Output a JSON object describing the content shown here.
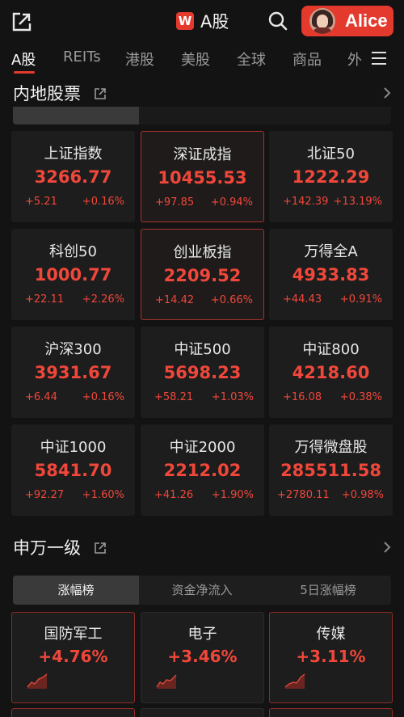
{
  "header": {
    "title": "A股",
    "logo_letter": "W",
    "user_name": "Alice"
  },
  "nav_tabs": [
    "A股",
    "REITs",
    "港股",
    "美股",
    "全球",
    "商品",
    "外"
  ],
  "mainland": {
    "title": "内地股票",
    "cards": [
      {
        "name": "上证指数",
        "price": "3266.77",
        "change": "+5.21",
        "pct": "+0.16%"
      },
      {
        "name": "深证成指",
        "price": "10455.53",
        "change": "+97.85",
        "pct": "+0.94%"
      },
      {
        "name": "北证50",
        "price": "1222.29",
        "change": "+142.39",
        "pct": "+13.19%"
      },
      {
        "name": "科创50",
        "price": "1000.77",
        "change": "+22.11",
        "pct": "+2.26%"
      },
      {
        "name": "创业板指",
        "price": "2209.52",
        "change": "+14.42",
        "pct": "+0.66%"
      },
      {
        "name": "万得全A",
        "price": "4933.83",
        "change": "+44.43",
        "pct": "+0.91%"
      },
      {
        "name": "沪深300",
        "price": "3931.67",
        "change": "+6.44",
        "pct": "+0.16%"
      },
      {
        "name": "中证500",
        "price": "5698.23",
        "change": "+58.21",
        "pct": "+1.03%"
      },
      {
        "name": "中证800",
        "price": "4218.60",
        "change": "+16.08",
        "pct": "+0.38%"
      },
      {
        "name": "中证1000",
        "price": "5841.70",
        "change": "+92.27",
        "pct": "+1.60%"
      },
      {
        "name": "中证2000",
        "price": "2212.02",
        "change": "+41.26",
        "pct": "+1.90%"
      },
      {
        "name": "万得微盘股",
        "price": "285511.58",
        "change": "+2780.11",
        "pct": "+0.98%"
      }
    ]
  },
  "industry": {
    "title": "申万一级",
    "subtabs": [
      "涨幅榜",
      "资金净流入",
      "5日涨幅榜"
    ],
    "cards": [
      {
        "name": "国防军工",
        "pct": "+4.76%"
      },
      {
        "name": "电子",
        "pct": "+3.46%"
      },
      {
        "name": "传媒",
        "pct": "+3.11%"
      }
    ]
  },
  "colors": {
    "accent": "#e4392d",
    "up": "#f0473a",
    "background": "#131313",
    "card": "#1d1d1d"
  }
}
